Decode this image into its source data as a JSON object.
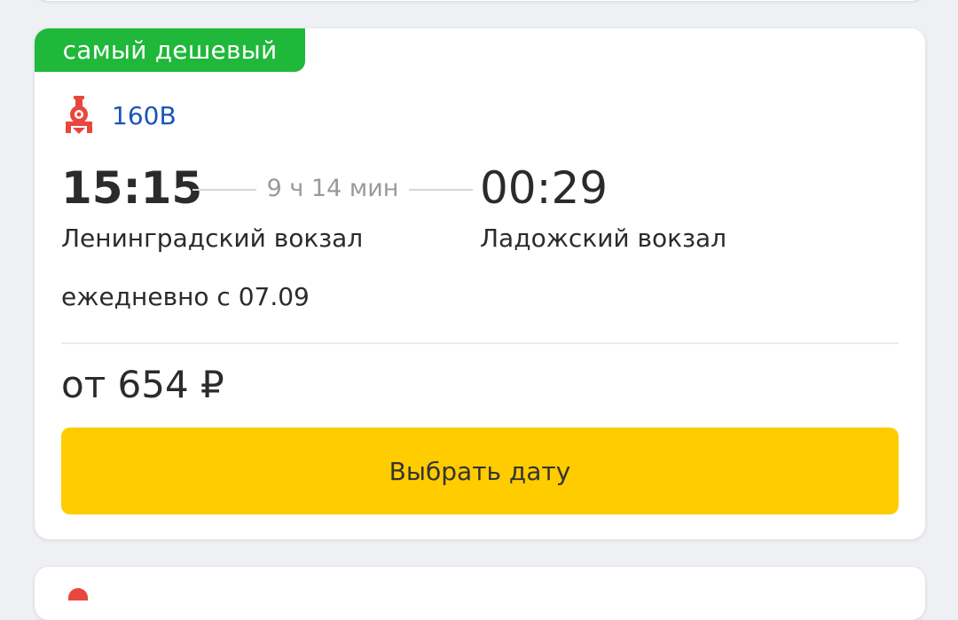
{
  "offer": {
    "badge": "самый дешевый",
    "train_number": "160В",
    "train_icon": "locomotive-icon",
    "departure": {
      "time": "15:15",
      "station": "Ленинградский вокзал"
    },
    "duration": "9 ч 14 мин",
    "arrival": {
      "time": "00:29",
      "station": "Ладожский вокзал"
    },
    "schedule": "ежедневно с 07.09",
    "price": "от 654 ₽",
    "button_label": "Выбрать дату"
  },
  "colors": {
    "badge": "#1fb83a",
    "train_number": "#1a55b8",
    "train_icon": "#e8473d",
    "button": "#ffcc00",
    "background": "#eef0f3"
  }
}
